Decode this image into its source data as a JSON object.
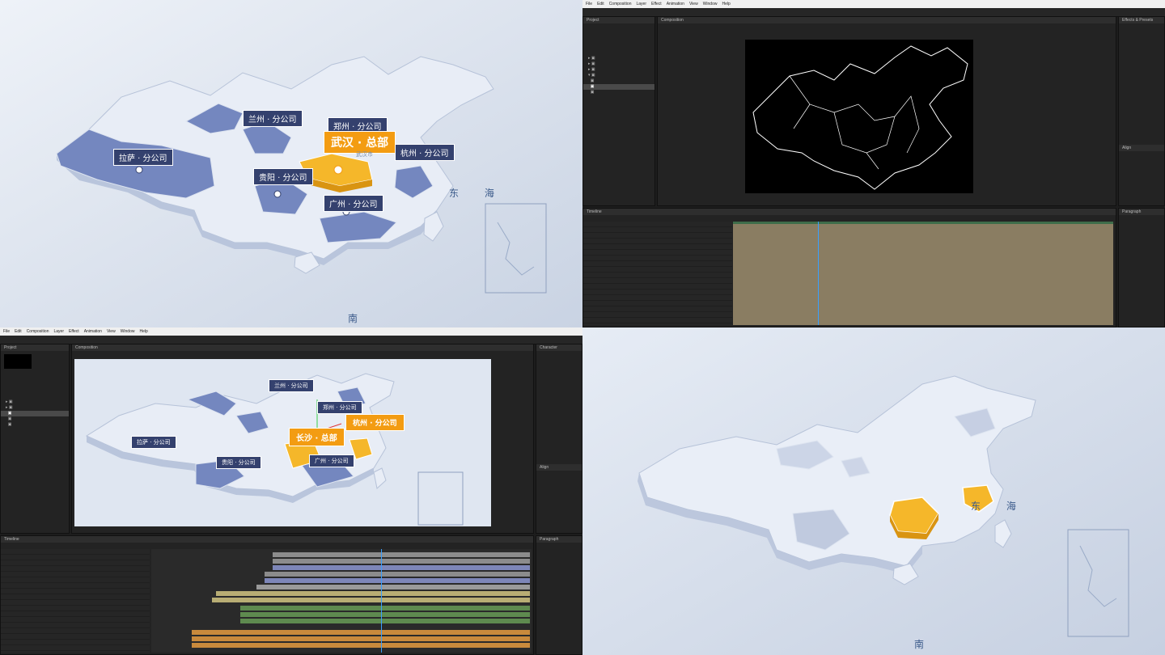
{
  "seas": {
    "east_sea": "东 海",
    "south": "南"
  },
  "top_left": {
    "labels": {
      "lanzhou": "兰州 · 分公司",
      "zhengzhou": "郑州 · 分公司",
      "wuhan": "武汉 · 总部",
      "wuhan_sub": "武汉市",
      "hangzhou": "杭州 · 分公司",
      "lhasa": "拉萨 · 分公司",
      "guiyang": "贵阳 · 分公司",
      "guangzhou": "广州 · 分公司"
    }
  },
  "bottom_left": {
    "labels": {
      "lanzhou": "兰州 · 分公司",
      "zhengzhou": "郑州 · 分公司",
      "hangzhou": "杭州 · 分公司",
      "changsha": "长沙 · 总部",
      "lhasa": "拉萨 · 分公司",
      "guiyang": "贵阳 · 分公司",
      "guangzhou": "广州 · 分公司"
    }
  },
  "ae_menu": [
    "File",
    "Edit",
    "Composition",
    "Layer",
    "Effect",
    "Animation",
    "View",
    "Window",
    "Help"
  ],
  "ae_panels": {
    "project": "Project",
    "composition": "Composition",
    "timeline": "Timeline",
    "effects": "Effects & Presets",
    "align": "Align",
    "character": "Character",
    "paragraph": "Paragraph"
  },
  "colors": {
    "highlight": "#f5b72a",
    "branch": "#6f84bd",
    "land": "#e9eef7",
    "background": "#d6deea"
  }
}
